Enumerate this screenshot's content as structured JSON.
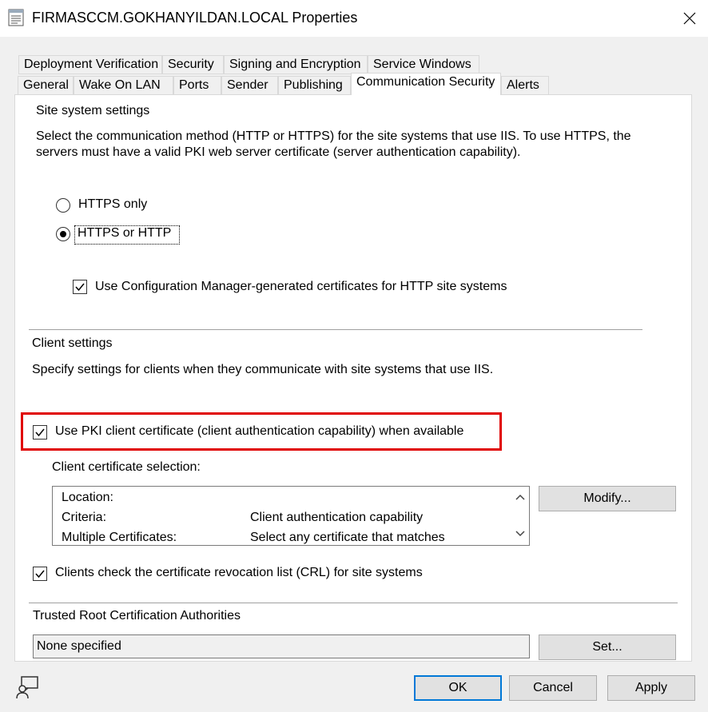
{
  "window": {
    "title": "FIRMASCCM.GOKHANYILDAN.LOCAL Properties"
  },
  "tabs_row1": [
    "Deployment Verification",
    "Security",
    "Signing and Encryption",
    "Service Windows"
  ],
  "tabs_row2": [
    "General",
    "Wake On LAN",
    "Ports",
    "Sender",
    "Publishing",
    "Communication Security",
    "Alerts"
  ],
  "active_tab": "Communication Security",
  "site_system": {
    "heading": "Site system settings",
    "description_line1": "Select the communication method (HTTP or HTTPS) for the site systems that use IIS. To use HTTPS, the",
    "description_line2": "servers must have a valid PKI web server certificate (server authentication capability).",
    "radio_https_only": "HTTPS only",
    "radio_https_or_http": "HTTPS or HTTP",
    "selected_radio": "HTTPS or HTTP",
    "use_cm_certs_label": "Use Configuration Manager-generated certificates for HTTP site systems",
    "use_cm_certs_checked": true
  },
  "client": {
    "heading": "Client settings",
    "description": "Specify settings for clients when they communicate with site systems that use IIS.",
    "use_pki_label": "Use PKI client certificate (client authentication capability) when available",
    "use_pki_checked": true,
    "cert_selection_label": "Client certificate selection:",
    "cert_selection": [
      {
        "key": "Location:",
        "value": ""
      },
      {
        "key": "Criteria:",
        "value": "Client authentication capability"
      },
      {
        "key": "Multiple Certificates:",
        "value": "Select any certificate that matches"
      }
    ],
    "modify_button": "Modify...",
    "crl_label": "Clients check the certificate revocation list (CRL) for site systems",
    "crl_checked": true
  },
  "trusted_root": {
    "heading": "Trusted Root Certification Authorities",
    "value": "None specified",
    "set_button": "Set..."
  },
  "footer": {
    "ok": "OK",
    "cancel": "Cancel",
    "apply": "Apply"
  },
  "colors": {
    "highlight_border": "#e00000",
    "default_button_border": "#0078d7"
  },
  "icons": [
    "properties-app-icon",
    "close-icon",
    "help-person-icon",
    "checkmark-icon",
    "chevron-up-icon",
    "chevron-down-icon"
  ]
}
